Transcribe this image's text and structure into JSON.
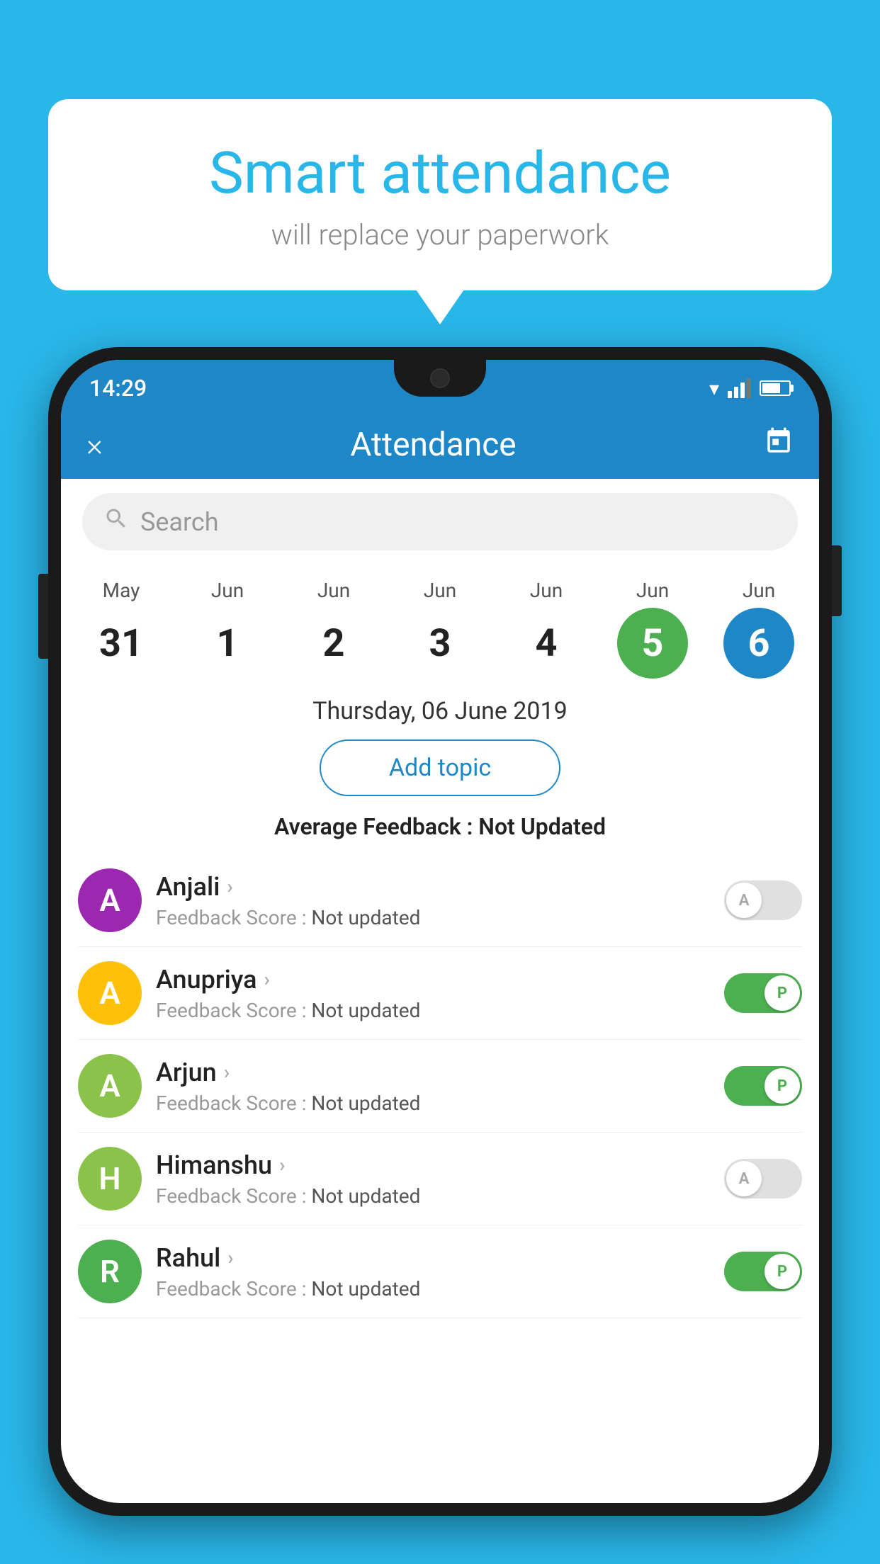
{
  "background": {
    "color": "#29b6e8"
  },
  "speech_bubble": {
    "title": "Smart attendance",
    "subtitle": "will replace your paperwork"
  },
  "phone": {
    "status_bar": {
      "time": "14:29"
    },
    "header": {
      "title": "Attendance",
      "close_label": "×",
      "calendar_icon_name": "calendar-icon"
    },
    "search": {
      "placeholder": "Search"
    },
    "calendar": {
      "days": [
        {
          "month": "May",
          "date": "31",
          "state": "normal"
        },
        {
          "month": "Jun",
          "date": "1",
          "state": "normal"
        },
        {
          "month": "Jun",
          "date": "2",
          "state": "normal"
        },
        {
          "month": "Jun",
          "date": "3",
          "state": "normal"
        },
        {
          "month": "Jun",
          "date": "4",
          "state": "normal"
        },
        {
          "month": "Jun",
          "date": "5",
          "state": "today"
        },
        {
          "month": "Jun",
          "date": "6",
          "state": "selected"
        }
      ]
    },
    "selected_date_label": "Thursday, 06 June 2019",
    "add_topic_btn": "Add topic",
    "avg_feedback_label": "Average Feedback :",
    "avg_feedback_value": "Not Updated",
    "students": [
      {
        "name": "Anjali",
        "feedback_label": "Feedback Score :",
        "feedback_value": "Not updated",
        "avatar_letter": "A",
        "avatar_color": "#9c27b0",
        "attendance": "absent",
        "toggle_letter": "A"
      },
      {
        "name": "Anupriya",
        "feedback_label": "Feedback Score :",
        "feedback_value": "Not updated",
        "avatar_letter": "A",
        "avatar_color": "#ffc107",
        "attendance": "present",
        "toggle_letter": "P"
      },
      {
        "name": "Arjun",
        "feedback_label": "Feedback Score :",
        "feedback_value": "Not updated",
        "avatar_letter": "A",
        "avatar_color": "#8bc34a",
        "attendance": "present",
        "toggle_letter": "P"
      },
      {
        "name": "Himanshu",
        "feedback_label": "Feedback Score :",
        "feedback_value": "Not updated",
        "avatar_letter": "H",
        "avatar_color": "#8bc34a",
        "attendance": "absent",
        "toggle_letter": "A"
      },
      {
        "name": "Rahul",
        "feedback_label": "Feedback Score :",
        "feedback_value": "Not updated",
        "avatar_letter": "R",
        "avatar_color": "#4caf50",
        "attendance": "present",
        "toggle_letter": "P"
      }
    ]
  }
}
